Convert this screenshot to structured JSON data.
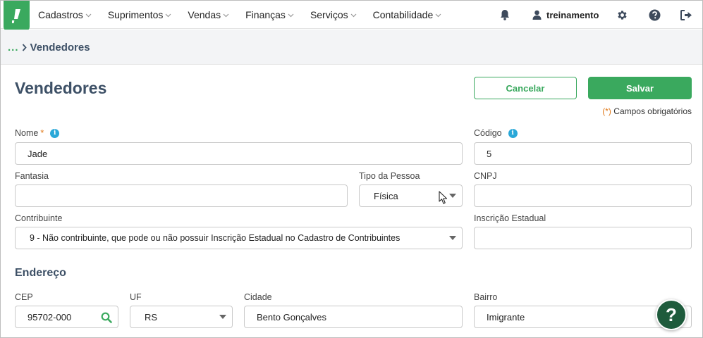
{
  "nav": {
    "menu": [
      {
        "label": "Cadastros"
      },
      {
        "label": "Suprimentos"
      },
      {
        "label": "Vendas"
      },
      {
        "label": "Finanças"
      },
      {
        "label": "Serviços"
      },
      {
        "label": "Contabilidade"
      }
    ],
    "user_name": "treinamento",
    "icons": [
      "bell-icon",
      "user-icon",
      "gear-icon",
      "question-circle-icon",
      "sign-out-icon"
    ],
    "logo_icon": "exclamation-logo-icon"
  },
  "breadcrumb": {
    "ellipsis": "...",
    "current": "Vendedores"
  },
  "page": {
    "title": "Vendedores",
    "cancel_label": "Cancelar",
    "save_label": "Salvar",
    "required_marker": "(*)",
    "required_text": " Campos obrigatórios"
  },
  "form": {
    "nome": {
      "label": "Nome",
      "required_mark": "*",
      "value": "Jade"
    },
    "codigo": {
      "label": "Código",
      "value": "5"
    },
    "fantasia": {
      "label": "Fantasia",
      "value": ""
    },
    "tipo_pessoa": {
      "label": "Tipo da Pessoa",
      "value": "Física"
    },
    "cnpj": {
      "label": "CNPJ",
      "value": ""
    },
    "contribuinte": {
      "label": "Contribuinte",
      "value": "9 - Não contribuinte, que pode ou não possuir Inscrição Estadual no Cadastro de Contribuintes"
    },
    "inscricao_estadual": {
      "label": "Inscrição Estadual",
      "value": ""
    }
  },
  "endereco": {
    "title": "Endereço",
    "cep": {
      "label": "CEP",
      "value": "95702-000"
    },
    "uf": {
      "label": "UF",
      "value": "RS"
    },
    "cidade": {
      "label": "Cidade",
      "value": "Bento Gonçalves"
    },
    "bairro": {
      "label": "Bairro",
      "value": "Imigrante"
    }
  },
  "help_fab_label": "?",
  "colors": {
    "brand_green": "#3aa95e",
    "dark_green": "#1e5b3c",
    "heading": "#3d5066",
    "info_blue": "#2aa8d8",
    "required_orange": "#e07a1c"
  }
}
